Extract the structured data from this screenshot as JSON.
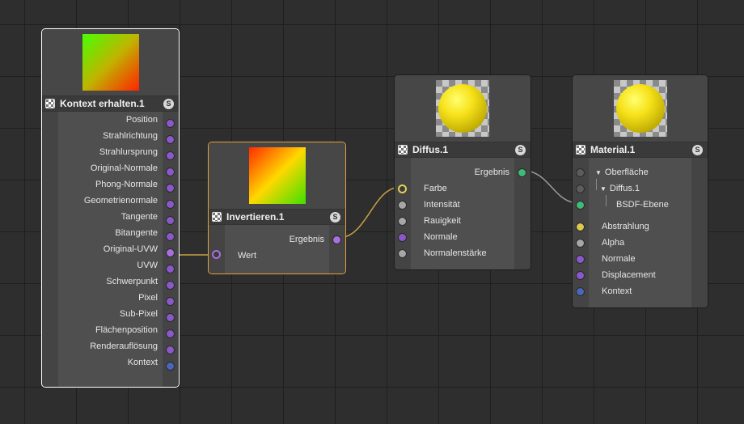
{
  "nodes": {
    "kontext": {
      "title": "Kontext erhalten.1",
      "solo": "S",
      "outputs": [
        "Position",
        "Strahlrichtung",
        "Strahlursprung",
        "Original-Normale",
        "Phong-Normale",
        "Geometrienormale",
        "Tangente",
        "Bitangente",
        "Original-UVW",
        "UVW",
        "Schwerpunkt",
        "Pixel",
        "Sub-Pixel",
        "Flächenposition",
        "Renderauflösung",
        "Kontext"
      ]
    },
    "invertieren": {
      "title": "Invertieren.1",
      "solo": "S",
      "output": "Ergebnis",
      "input": "Wert"
    },
    "diffus": {
      "title": "Diffus.1",
      "solo": "S",
      "output": "Ergebnis",
      "inputs": [
        "Farbe",
        "Intensität",
        "Rauigkeit",
        "Normale",
        "Normalenstärke"
      ]
    },
    "material": {
      "title": "Material.1",
      "solo": "S",
      "tree": [
        "Oberfläche",
        "Diffus.1",
        "BSDF-Ebene"
      ],
      "inputs": [
        "Abstrahlung",
        "Alpha",
        "Normale",
        "Displacement",
        "Kontext"
      ]
    }
  },
  "colors": {
    "wire": "#c8a040",
    "wire_gray": "#9a9a9a",
    "selected_border": "#ffffff",
    "active_border": "#e3a23b"
  }
}
